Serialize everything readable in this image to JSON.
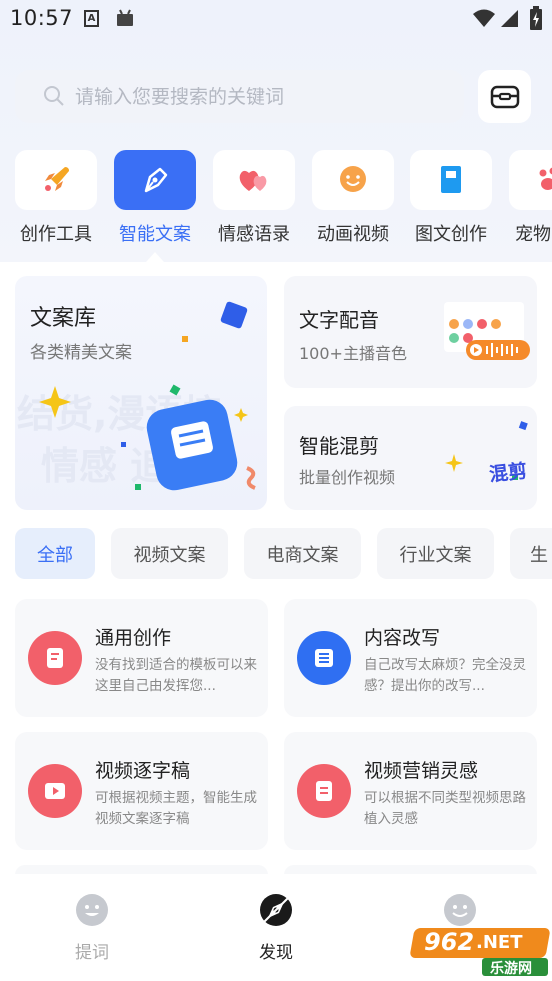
{
  "status_bar": {
    "time": "10:57"
  },
  "search": {
    "placeholder": "请输入您要搜索的关键词"
  },
  "categories": [
    {
      "label": "创作工具",
      "icon": "rocket-icon"
    },
    {
      "label": "智能文案",
      "icon": "pen-nib-icon",
      "active": true
    },
    {
      "label": "情感语录",
      "icon": "hearts-icon"
    },
    {
      "label": "动画视频",
      "icon": "smiley-icon"
    },
    {
      "label": "图文创作",
      "icon": "book-icon"
    },
    {
      "label": "宠物",
      "icon": "paw-icon"
    }
  ],
  "features": {
    "library": {
      "title": "文案库",
      "subtitle": "各类精美文案",
      "watermark_line1": "结货,漫语搞",
      "watermark_line2": "情感  追剧"
    },
    "dubbing": {
      "title": "文字配音",
      "subtitle": "100+主播音色"
    },
    "remix": {
      "title": "智能混剪",
      "subtitle": "批量创作视频",
      "badge": "混剪"
    }
  },
  "filters": [
    "全部",
    "视频文案",
    "电商文案",
    "行业文案",
    "生"
  ],
  "templates": [
    {
      "title": "通用创作",
      "desc": "没有找到适合的模板可以来这里自己由发挥您...",
      "color": "#f2606a"
    },
    {
      "title": "内容改写",
      "desc": "自己改写太麻烦？完全没灵感？提出你的改写...",
      "color": "#2f6ff2"
    },
    {
      "title": "视频逐字稿",
      "desc": "可根据视频主题，智能生成视频文案逐字稿",
      "color": "#f2606a"
    },
    {
      "title": "视频营销灵感",
      "desc": "可以根据不同类型视频思路植入灵感",
      "color": "#f2606a"
    }
  ],
  "bottom_nav": [
    {
      "label": "提词",
      "icon": "face-icon"
    },
    {
      "label": "发现",
      "icon": "compass-icon",
      "active": true
    },
    {
      "label": "",
      "icon": "face-icon"
    }
  ],
  "watermark": {
    "text1": "962",
    "text2": ".NET",
    "text3": "乐游网"
  },
  "colors": {
    "accent": "#3a6ff5",
    "red": "#f2606a"
  }
}
